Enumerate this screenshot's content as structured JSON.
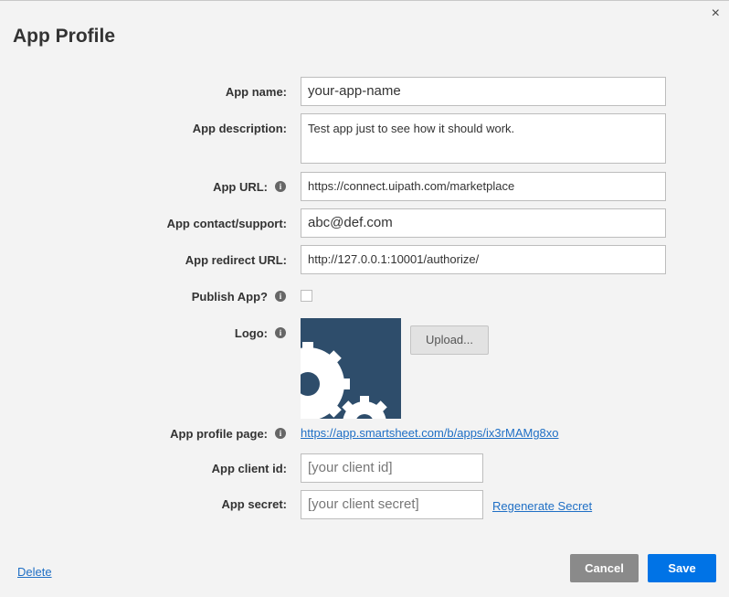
{
  "dialog": {
    "title": "App Profile",
    "close_icon": "×"
  },
  "form": {
    "app_name": {
      "label": "App name:",
      "value": "your-app-name"
    },
    "app_description": {
      "label": "App description:",
      "value": "Test app just to see how it should work."
    },
    "app_url": {
      "label": "App URL:",
      "value": "https://connect.uipath.com/marketplace"
    },
    "app_contact": {
      "label": "App contact/support:",
      "value": "abc@def.com"
    },
    "app_redirect_url": {
      "label": "App redirect URL:",
      "value": "http://127.0.0.1:10001/authorize/"
    },
    "publish_app": {
      "label": "Publish App?",
      "checked": false
    },
    "logo": {
      "label": "Logo:",
      "upload_label": "Upload..."
    },
    "app_profile_page": {
      "label": "App profile page:",
      "link": "https://app.smartsheet.com/b/apps/ix3rMAMg8xo"
    },
    "app_client_id": {
      "label": "App client id:",
      "value": "[your client id]"
    },
    "app_secret": {
      "label": "App secret:",
      "value": "[your client secret]",
      "regenerate_label": "Regenerate Secret"
    }
  },
  "info_icon_glyph": "i",
  "footer": {
    "delete_label": "Delete",
    "cancel_label": "Cancel",
    "save_label": "Save"
  },
  "colors": {
    "save": "#0073e6",
    "cancel": "#8a8a8a",
    "logo_bg": "#2e4d6b",
    "link": "#1f6fc5"
  },
  "icons": [
    "close-icon",
    "info-icon",
    "gear-icon"
  ]
}
